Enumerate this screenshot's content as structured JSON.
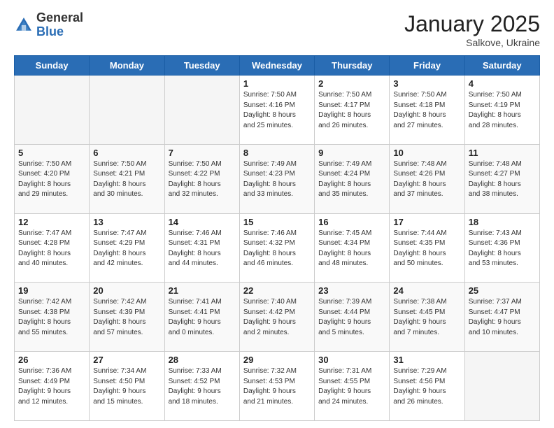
{
  "header": {
    "logo_general": "General",
    "logo_blue": "Blue",
    "month_year": "January 2025",
    "location": "Salkove, Ukraine"
  },
  "days_of_week": [
    "Sunday",
    "Monday",
    "Tuesday",
    "Wednesday",
    "Thursday",
    "Friday",
    "Saturday"
  ],
  "weeks": [
    [
      {
        "day": "",
        "detail": ""
      },
      {
        "day": "",
        "detail": ""
      },
      {
        "day": "",
        "detail": ""
      },
      {
        "day": "1",
        "detail": "Sunrise: 7:50 AM\nSunset: 4:16 PM\nDaylight: 8 hours\nand 25 minutes."
      },
      {
        "day": "2",
        "detail": "Sunrise: 7:50 AM\nSunset: 4:17 PM\nDaylight: 8 hours\nand 26 minutes."
      },
      {
        "day": "3",
        "detail": "Sunrise: 7:50 AM\nSunset: 4:18 PM\nDaylight: 8 hours\nand 27 minutes."
      },
      {
        "day": "4",
        "detail": "Sunrise: 7:50 AM\nSunset: 4:19 PM\nDaylight: 8 hours\nand 28 minutes."
      }
    ],
    [
      {
        "day": "5",
        "detail": "Sunrise: 7:50 AM\nSunset: 4:20 PM\nDaylight: 8 hours\nand 29 minutes."
      },
      {
        "day": "6",
        "detail": "Sunrise: 7:50 AM\nSunset: 4:21 PM\nDaylight: 8 hours\nand 30 minutes."
      },
      {
        "day": "7",
        "detail": "Sunrise: 7:50 AM\nSunset: 4:22 PM\nDaylight: 8 hours\nand 32 minutes."
      },
      {
        "day": "8",
        "detail": "Sunrise: 7:49 AM\nSunset: 4:23 PM\nDaylight: 8 hours\nand 33 minutes."
      },
      {
        "day": "9",
        "detail": "Sunrise: 7:49 AM\nSunset: 4:24 PM\nDaylight: 8 hours\nand 35 minutes."
      },
      {
        "day": "10",
        "detail": "Sunrise: 7:48 AM\nSunset: 4:26 PM\nDaylight: 8 hours\nand 37 minutes."
      },
      {
        "day": "11",
        "detail": "Sunrise: 7:48 AM\nSunset: 4:27 PM\nDaylight: 8 hours\nand 38 minutes."
      }
    ],
    [
      {
        "day": "12",
        "detail": "Sunrise: 7:47 AM\nSunset: 4:28 PM\nDaylight: 8 hours\nand 40 minutes."
      },
      {
        "day": "13",
        "detail": "Sunrise: 7:47 AM\nSunset: 4:29 PM\nDaylight: 8 hours\nand 42 minutes."
      },
      {
        "day": "14",
        "detail": "Sunrise: 7:46 AM\nSunset: 4:31 PM\nDaylight: 8 hours\nand 44 minutes."
      },
      {
        "day": "15",
        "detail": "Sunrise: 7:46 AM\nSunset: 4:32 PM\nDaylight: 8 hours\nand 46 minutes."
      },
      {
        "day": "16",
        "detail": "Sunrise: 7:45 AM\nSunset: 4:34 PM\nDaylight: 8 hours\nand 48 minutes."
      },
      {
        "day": "17",
        "detail": "Sunrise: 7:44 AM\nSunset: 4:35 PM\nDaylight: 8 hours\nand 50 minutes."
      },
      {
        "day": "18",
        "detail": "Sunrise: 7:43 AM\nSunset: 4:36 PM\nDaylight: 8 hours\nand 53 minutes."
      }
    ],
    [
      {
        "day": "19",
        "detail": "Sunrise: 7:42 AM\nSunset: 4:38 PM\nDaylight: 8 hours\nand 55 minutes."
      },
      {
        "day": "20",
        "detail": "Sunrise: 7:42 AM\nSunset: 4:39 PM\nDaylight: 8 hours\nand 57 minutes."
      },
      {
        "day": "21",
        "detail": "Sunrise: 7:41 AM\nSunset: 4:41 PM\nDaylight: 9 hours\nand 0 minutes."
      },
      {
        "day": "22",
        "detail": "Sunrise: 7:40 AM\nSunset: 4:42 PM\nDaylight: 9 hours\nand 2 minutes."
      },
      {
        "day": "23",
        "detail": "Sunrise: 7:39 AM\nSunset: 4:44 PM\nDaylight: 9 hours\nand 5 minutes."
      },
      {
        "day": "24",
        "detail": "Sunrise: 7:38 AM\nSunset: 4:45 PM\nDaylight: 9 hours\nand 7 minutes."
      },
      {
        "day": "25",
        "detail": "Sunrise: 7:37 AM\nSunset: 4:47 PM\nDaylight: 9 hours\nand 10 minutes."
      }
    ],
    [
      {
        "day": "26",
        "detail": "Sunrise: 7:36 AM\nSunset: 4:49 PM\nDaylight: 9 hours\nand 12 minutes."
      },
      {
        "day": "27",
        "detail": "Sunrise: 7:34 AM\nSunset: 4:50 PM\nDaylight: 9 hours\nand 15 minutes."
      },
      {
        "day": "28",
        "detail": "Sunrise: 7:33 AM\nSunset: 4:52 PM\nDaylight: 9 hours\nand 18 minutes."
      },
      {
        "day": "29",
        "detail": "Sunrise: 7:32 AM\nSunset: 4:53 PM\nDaylight: 9 hours\nand 21 minutes."
      },
      {
        "day": "30",
        "detail": "Sunrise: 7:31 AM\nSunset: 4:55 PM\nDaylight: 9 hours\nand 24 minutes."
      },
      {
        "day": "31",
        "detail": "Sunrise: 7:29 AM\nSunset: 4:56 PM\nDaylight: 9 hours\nand 26 minutes."
      },
      {
        "day": "",
        "detail": ""
      }
    ]
  ]
}
